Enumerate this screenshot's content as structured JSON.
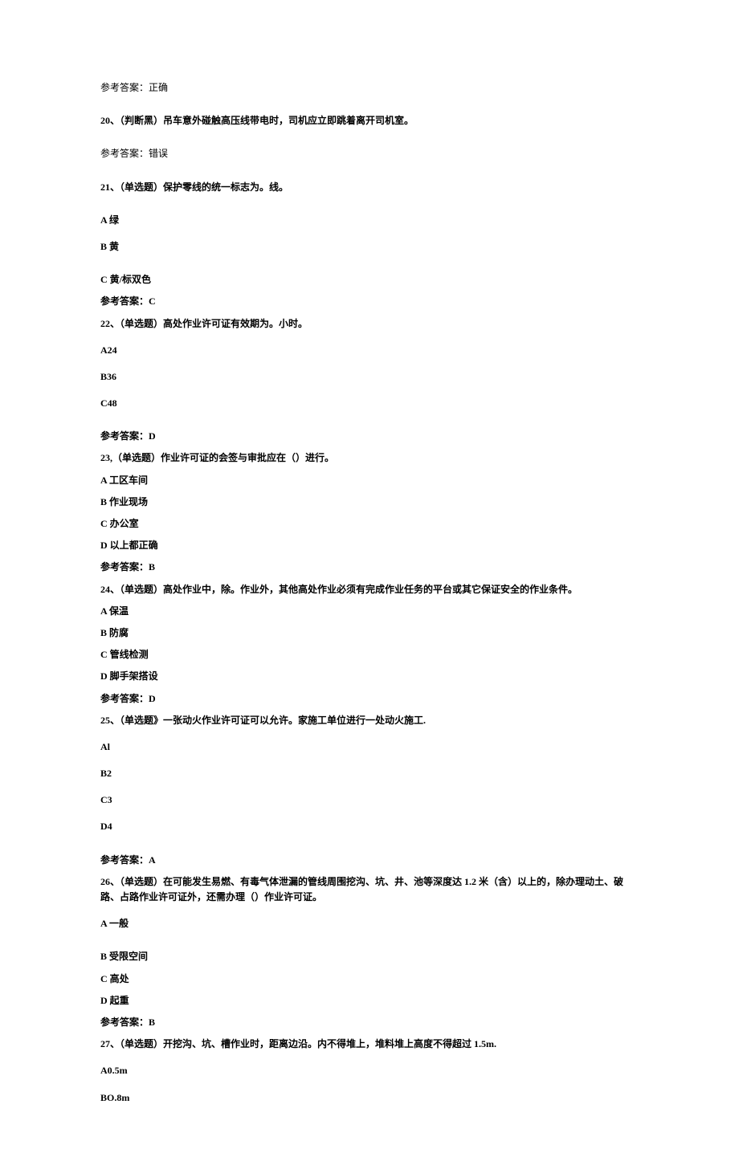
{
  "lines": [
    {
      "text": "参考答案：正确",
      "cls": "line gap-after"
    },
    {
      "text": "20、（判断黑）吊车意外碰触高压线带电时，司机应立即跳着离开司机室。",
      "cls": "line gap-after bold"
    },
    {
      "text": "参考答案：错误",
      "cls": "line gap-after"
    },
    {
      "text": "21、（单选题）保护零线的统一标志为。线。",
      "cls": "line gap-after bold"
    },
    {
      "text": "A 绿",
      "cls": "line bold"
    },
    {
      "text": "B 黄",
      "cls": "line gap-after bold"
    },
    {
      "text": "C 黄/标双色",
      "cls": "line-tight bold"
    },
    {
      "text": "参考答案：C",
      "cls": "line-tight bold"
    },
    {
      "text": "22、（单选题）高处作业许可证有效期为。小时。",
      "cls": "line bold"
    },
    {
      "text": "A24",
      "cls": "line bold"
    },
    {
      "text": "B36",
      "cls": "line bold"
    },
    {
      "text": "C48",
      "cls": "line gap-after bold"
    },
    {
      "text": "参考答案：D",
      "cls": "line-tight bold"
    },
    {
      "text": "23,（单选题）作业许可证的会签与审批应在（）进行。",
      "cls": "line-tight bold"
    },
    {
      "text": "A 工区车间",
      "cls": "line-tight bold"
    },
    {
      "text": "B 作业现场",
      "cls": "line-tight bold"
    },
    {
      "text": "C 办公室",
      "cls": "line-tight bold"
    },
    {
      "text": "D 以上都正确",
      "cls": "line-tight bold"
    },
    {
      "text": "参考答案：B",
      "cls": "line-tight bold"
    },
    {
      "text": "24、（单选题）高处作业中，除。作业外，其他高处作业必须有完成作业任务的平台或其它保证安全的作业条件。",
      "cls": "line-tight bold"
    },
    {
      "text": "A 保温",
      "cls": "line-tight bold"
    },
    {
      "text": "B 防腐",
      "cls": "line-tight bold"
    },
    {
      "text": "C 管线检测",
      "cls": "line-tight bold"
    },
    {
      "text": "D 脚手架搭设",
      "cls": "line-tight bold"
    },
    {
      "text": "参考答案：D",
      "cls": "line-tight bold"
    },
    {
      "text": "25、（单选题》一张动火作业许可证可以允许。家施工单位进行一处动火施工.",
      "cls": "line bold"
    },
    {
      "text": "Al",
      "cls": "line bold"
    },
    {
      "text": "B2",
      "cls": "line bold"
    },
    {
      "text": "C3",
      "cls": "line bold"
    },
    {
      "text": "D4",
      "cls": "line gap-after bold"
    },
    {
      "text": "参考答案：A",
      "cls": "line-tight bold"
    },
    {
      "text": "26、（单选题）在可能发生易燃、有毒气体泄漏的管线周围挖沟、坑、井、池等深度达 1.2 米（含）以上的，除办理动土、破路、占路作业许可证外，还需办理（）作业许可证。",
      "cls": "line bold"
    },
    {
      "text": "A 一般",
      "cls": "line gap-after bold"
    },
    {
      "text": "B 受限空间",
      "cls": "line-tight bold"
    },
    {
      "text": "C 高处",
      "cls": "line-tight bold"
    },
    {
      "text": "D 起重",
      "cls": "line-tight bold"
    },
    {
      "text": "参考答案：B",
      "cls": "line-tight bold"
    },
    {
      "text": "27、（单选题）开挖沟、坑、槽作业时，距离边沿。内不得堆上，堆料堆上高度不得超过 1.5m.",
      "cls": "line bold"
    },
    {
      "text": "A0.5m",
      "cls": "line bold"
    },
    {
      "text": "BO.8m",
      "cls": "line bold"
    }
  ]
}
